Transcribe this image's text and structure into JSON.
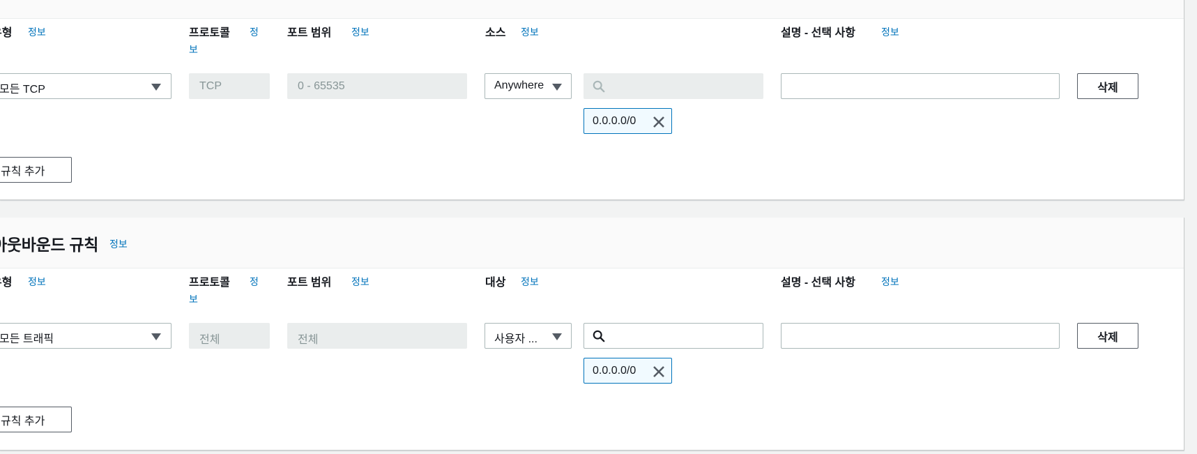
{
  "inbound": {
    "columns": {
      "type_label": "유형",
      "protocol_label": "프로토콜",
      "port_label": "포트 범위",
      "source_label": "소스",
      "desc_label": "설명 - 선택 사항"
    },
    "info_link": "정보",
    "info_link_split_a": "정",
    "info_link_split_b": "보",
    "rule": {
      "type_value": "모든 TCP",
      "protocol_value": "TCP",
      "port_value": "0 - 65535",
      "source_value": "Anywhere",
      "search_placeholder": "",
      "cidr_token": "0.0.0.0/0",
      "description_value": "",
      "delete_label": "삭제"
    },
    "add_rule_label": "규칙 추가"
  },
  "outbound": {
    "title": "아웃바운드 규칙",
    "info_link": "정보",
    "columns": {
      "type_label": "유형",
      "protocol_label": "프로토콜",
      "port_label": "포트 범위",
      "dest_label": "대상",
      "desc_label": "설명 - 선택 사항"
    },
    "info_link_split_a": "정",
    "info_link_split_b": "보",
    "rule": {
      "type_value": "모든 트래픽",
      "protocol_value": "전체",
      "port_value": "전체",
      "dest_value": "사용자 ...",
      "search_placeholder": "",
      "cidr_token": "0.0.0.0/0",
      "description_value": "",
      "delete_label": "삭제"
    },
    "add_rule_label": "규칙 추가"
  },
  "colors": {
    "link": "#0073bb",
    "border": "#aab7b8",
    "disabled_bg": "#eaeded",
    "token_border": "#0073bb",
    "token_bg": "#f1faff"
  },
  "icons": [
    "caret-down-icon",
    "search-icon",
    "close-icon"
  ]
}
